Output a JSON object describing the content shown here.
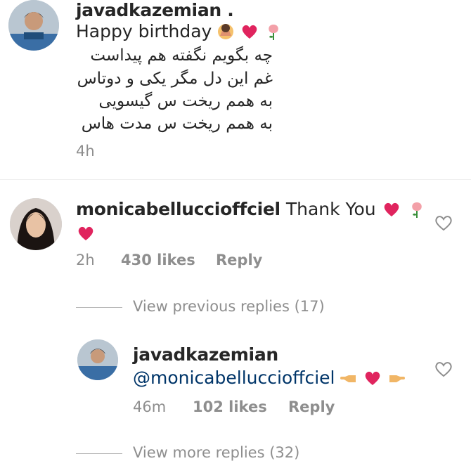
{
  "comment1": {
    "username": "javadkazemian .",
    "text_line1": "Happy birthday",
    "emojis": [
      "face-emoji",
      "red-heart-emoji",
      "rose-emoji"
    ],
    "persian_lines": [
      "چه بگویم نگفته هم پیداست",
      "غم این دل مگر یکی و دوتاس",
      "به همم ریخت س گیسویی",
      "به همم ریخت س مدت هاس"
    ],
    "time": "4h"
  },
  "comment2": {
    "username": "monicabelluccioffciel",
    "text": "Thank You",
    "emojis": [
      "red-heart-emoji",
      "rose-emoji",
      "red-heart-emoji"
    ],
    "time": "2h",
    "likes": "430 likes",
    "reply": "Reply"
  },
  "view_previous": "View previous replies (17)",
  "reply": {
    "username": "javadkazemian",
    "mention": "@monicabelluccioffciel",
    "emojis": [
      "pointing-left-emoji",
      "red-heart-emoji",
      "pointing-right-emoji"
    ],
    "time": "46m",
    "likes": "102 likes",
    "reply": "Reply"
  },
  "view_more": "View more replies (32)",
  "colors": {
    "text": "#262626",
    "muted": "#8e8e8e",
    "mention": "#003569",
    "heart": "#ed4956"
  }
}
